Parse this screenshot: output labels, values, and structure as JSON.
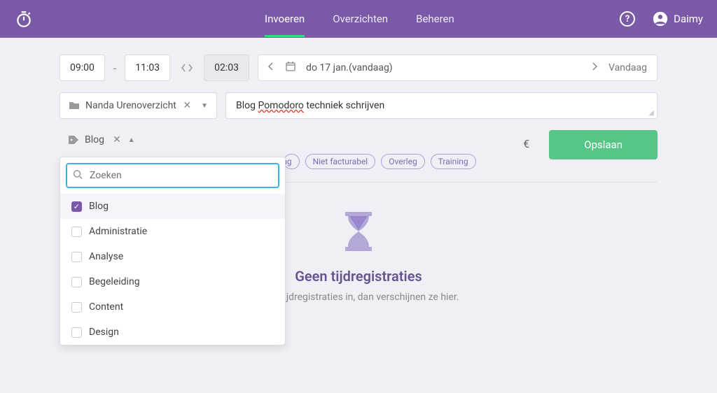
{
  "header": {
    "nav": {
      "invoeren": "Invoeren",
      "overzichten": "Overzichten",
      "beheren": "Beheren"
    },
    "user_name": "Daimy"
  },
  "entry": {
    "time_start": "09:00",
    "time_end": "11:03",
    "duration": "02:03",
    "date_text": "do 17 jan.(vandaag)",
    "today_label": "Vandaag",
    "project": "Nanda Urenoverzicht",
    "description_prefix": "Blog ",
    "description_underlined": "Pomodoro",
    "description_suffix": " techniek schrijven",
    "tag_label": "Blog",
    "save_label": "Opslaan",
    "currency_symbol": "€"
  },
  "dropdown": {
    "search_placeholder": "Zoeken",
    "options": [
      {
        "label": "Blog",
        "checked": true
      },
      {
        "label": "Administratie",
        "checked": false
      },
      {
        "label": "Analyse",
        "checked": false
      },
      {
        "label": "Begeleiding",
        "checked": false
      },
      {
        "label": "Content",
        "checked": false
      },
      {
        "label": "Design",
        "checked": false
      }
    ]
  },
  "tags": {
    "partial": "eting",
    "niet_facturabel": "Niet facturabel",
    "overleg": "Overleg",
    "training": "Training"
  },
  "empty_state": {
    "title": "Geen tijdregistraties",
    "subtitle": "Voer tijdregistraties in, dan verschijnen ze hier."
  }
}
